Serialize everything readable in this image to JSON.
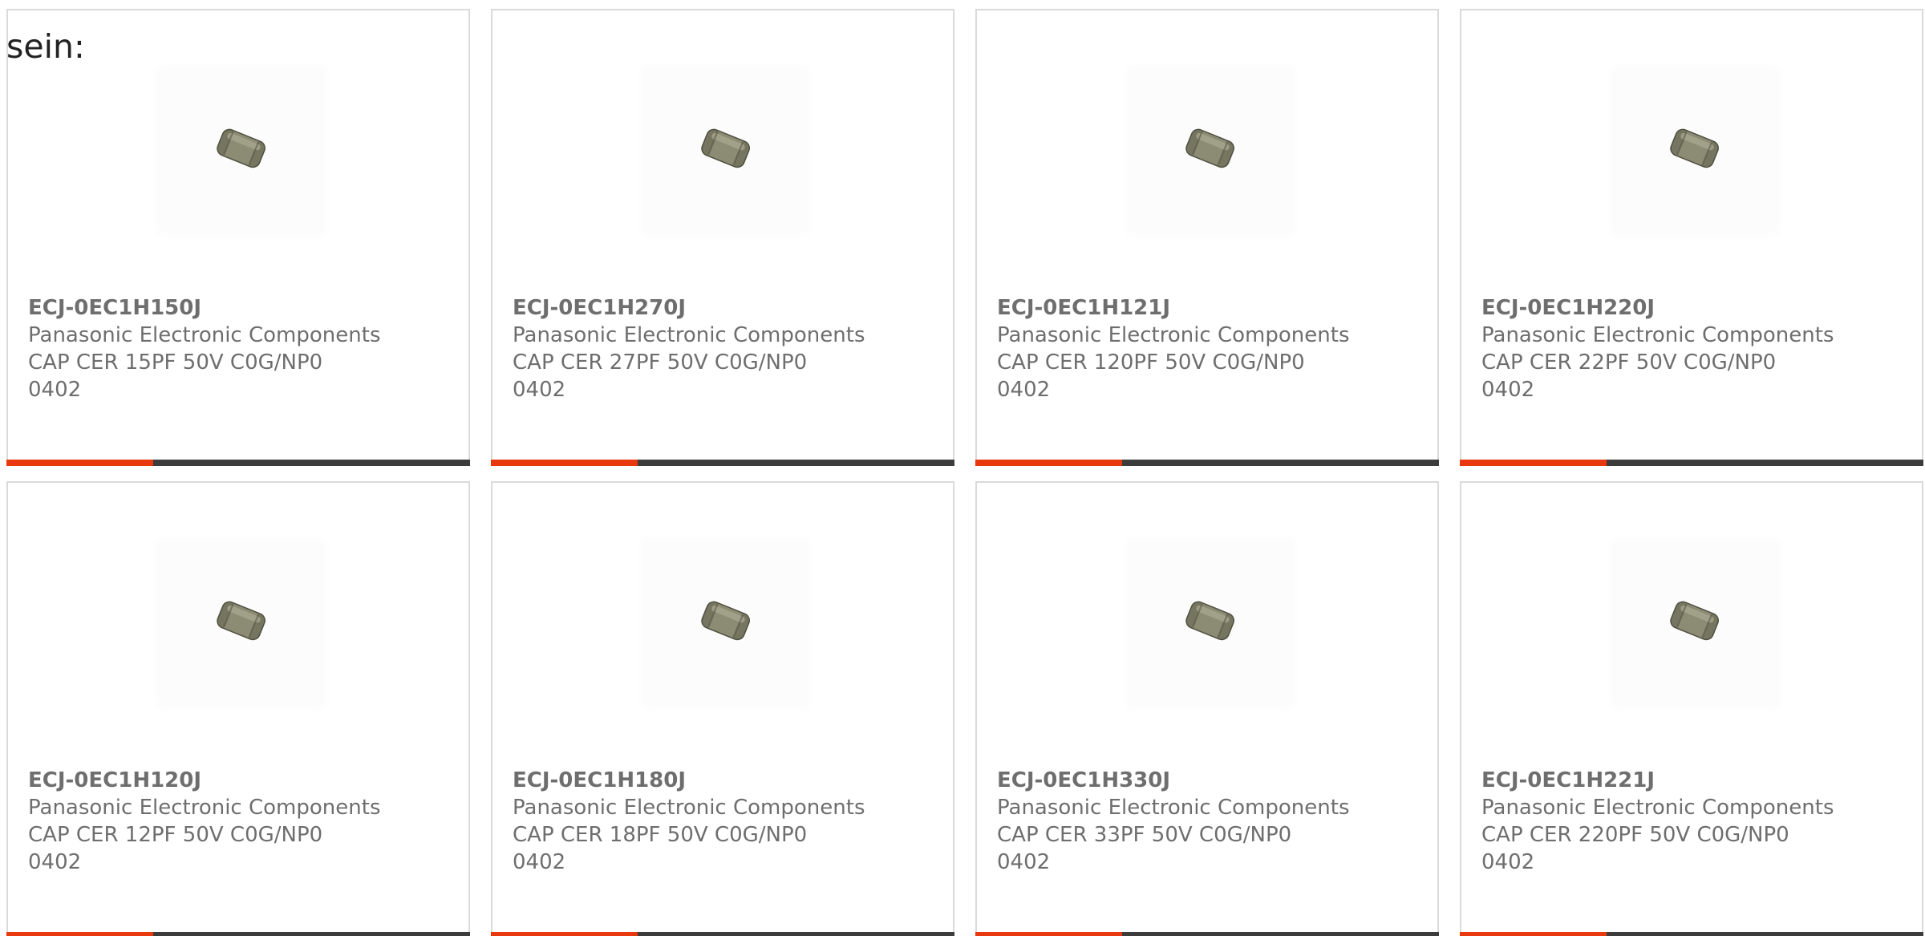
{
  "lead_text": "sein:",
  "colors": {
    "accent": "#e8380d",
    "bar": "#3c3c3c",
    "border": "#dadada",
    "text": "#6e6e6e"
  },
  "product_icon": "ceramic-capacitor-chip-icon",
  "products": [
    {
      "part_number": "ECJ-0EC1H150J",
      "manufacturer": "Panasonic Electronic Components",
      "description": "CAP CER 15PF 50V C0G/NP0",
      "package": "0402"
    },
    {
      "part_number": "ECJ-0EC1H270J",
      "manufacturer": "Panasonic Electronic Components",
      "description": "CAP CER 27PF 50V C0G/NP0",
      "package": "0402"
    },
    {
      "part_number": "ECJ-0EC1H121J",
      "manufacturer": "Panasonic Electronic Components",
      "description": "CAP CER 120PF 50V C0G/NP0",
      "package": "0402"
    },
    {
      "part_number": "ECJ-0EC1H220J",
      "manufacturer": "Panasonic Electronic Components",
      "description": "CAP CER 22PF 50V C0G/NP0",
      "package": "0402"
    },
    {
      "part_number": "ECJ-0EC1H120J",
      "manufacturer": "Panasonic Electronic Components",
      "description": "CAP CER 12PF 50V C0G/NP0",
      "package": "0402"
    },
    {
      "part_number": "ECJ-0EC1H180J",
      "manufacturer": "Panasonic Electronic Components",
      "description": "CAP CER 18PF 50V C0G/NP0",
      "package": "0402"
    },
    {
      "part_number": "ECJ-0EC1H330J",
      "manufacturer": "Panasonic Electronic Components",
      "description": "CAP CER 33PF 50V C0G/NP0",
      "package": "0402"
    },
    {
      "part_number": "ECJ-0EC1H221J",
      "manufacturer": "Panasonic Electronic Components",
      "description": "CAP CER 220PF 50V C0G/NP0",
      "package": "0402"
    }
  ]
}
